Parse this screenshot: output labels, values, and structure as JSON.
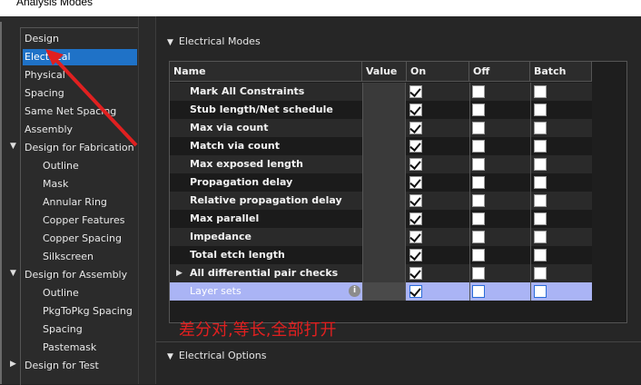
{
  "window": {
    "title": "Analysis Modes"
  },
  "tree": {
    "items": [
      {
        "label": "Design",
        "level": 0,
        "expander": ""
      },
      {
        "label": "Electrical",
        "level": 0,
        "expander": "",
        "selected": true
      },
      {
        "label": "Physical",
        "level": 0,
        "expander": ""
      },
      {
        "label": "Spacing",
        "level": 0,
        "expander": ""
      },
      {
        "label": "Same Net Spacing",
        "level": 0,
        "expander": ""
      },
      {
        "label": "Assembly",
        "level": 0,
        "expander": ""
      },
      {
        "label": "Design for Fabrication",
        "level": 0,
        "expander": "▼"
      },
      {
        "label": "Outline",
        "level": 1,
        "expander": ""
      },
      {
        "label": "Mask",
        "level": 1,
        "expander": ""
      },
      {
        "label": "Annular Ring",
        "level": 1,
        "expander": ""
      },
      {
        "label": "Copper Features",
        "level": 1,
        "expander": ""
      },
      {
        "label": "Copper Spacing",
        "level": 1,
        "expander": ""
      },
      {
        "label": "Silkscreen",
        "level": 1,
        "expander": ""
      },
      {
        "label": "Design for Assembly",
        "level": 0,
        "expander": "▼"
      },
      {
        "label": "Outline",
        "level": 1,
        "expander": ""
      },
      {
        "label": "PkgToPkg Spacing",
        "level": 1,
        "expander": ""
      },
      {
        "label": "Spacing",
        "level": 1,
        "expander": ""
      },
      {
        "label": "Pastemask",
        "level": 1,
        "expander": ""
      },
      {
        "label": "Design for Test",
        "level": 0,
        "expander": "▶"
      }
    ]
  },
  "sections": {
    "electrical_modes": {
      "label": "Electrical Modes",
      "triangle": "▼"
    },
    "electrical_options": {
      "label": "Electrical Options",
      "triangle": "▼"
    }
  },
  "grid": {
    "headers": {
      "name": "Name",
      "value": "Value",
      "on": "On",
      "off": "Off",
      "batch": "Batch"
    },
    "rows": [
      {
        "name": "Mark All Constraints",
        "on": true,
        "off": false,
        "batch": false
      },
      {
        "name": "Stub length/Net schedule",
        "on": true,
        "off": false,
        "batch": false
      },
      {
        "name": "Max via count",
        "on": true,
        "off": false,
        "batch": false
      },
      {
        "name": "Match via count",
        "on": true,
        "off": false,
        "batch": false
      },
      {
        "name": "Max exposed length",
        "on": true,
        "off": false,
        "batch": false
      },
      {
        "name": "Propagation delay",
        "on": true,
        "off": false,
        "batch": false
      },
      {
        "name": "Relative propagation delay",
        "on": true,
        "off": false,
        "batch": false
      },
      {
        "name": "Max parallel",
        "on": true,
        "off": false,
        "batch": false
      },
      {
        "name": "Impedance",
        "on": true,
        "off": false,
        "batch": false
      },
      {
        "name": "Total etch length",
        "on": true,
        "off": false,
        "batch": false
      },
      {
        "name": "All differential pair checks",
        "on": true,
        "off": false,
        "batch": false,
        "expander": "▶"
      },
      {
        "name": "Layer sets",
        "on": true,
        "off": false,
        "batch": false,
        "selected": true,
        "info": "i"
      }
    ]
  },
  "annotation": {
    "text": "差分对,等长,全部打开",
    "color": "#e02020"
  },
  "colors": {
    "selection": "#1f72c7",
    "row_selected": "#aab4f5",
    "arrow": "#e02020"
  }
}
